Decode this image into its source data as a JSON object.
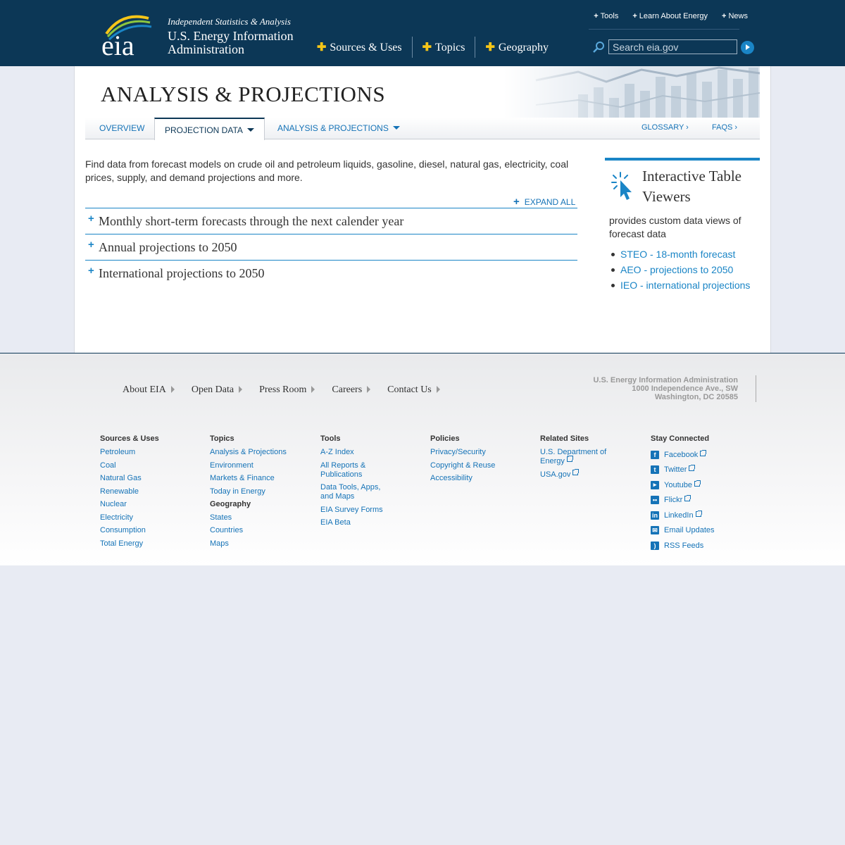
{
  "header": {
    "logo_text": "eia",
    "tagline": "Independent Statistics & Analysis",
    "org_line1": "U.S. Energy Information",
    "org_line2": "Administration",
    "main_nav": [
      "Sources & Uses",
      "Topics",
      "Geography"
    ],
    "util_nav": [
      "Tools",
      "Learn About Energy",
      "News"
    ],
    "search_placeholder": "Search eia.gov"
  },
  "banner": {
    "title": "ANALYSIS & PROJECTIONS"
  },
  "subnav": {
    "tabs": [
      "OVERVIEW",
      "PROJECTION DATA",
      "ANALYSIS & PROJECTIONS"
    ],
    "right_links": [
      "GLOSSARY ›",
      "FAQS ›"
    ],
    "active": "PROJECTION DATA"
  },
  "main": {
    "intro": "Find data from forecast models on crude oil and petroleum liquids, gasoline, diesel, natural gas, electricity, coal prices, supply, and demand projections and more.",
    "expand_all": "EXPAND ALL",
    "accordion": [
      "Monthly short-term forecasts through the next calender year",
      "Annual projections to 2050",
      "International projections to 2050"
    ]
  },
  "sidebar": {
    "title": "Interactive Table Viewers",
    "description": "provides custom data views of forecast data",
    "links": [
      "STEO - 18-month forecast",
      "AEO - projections to 2050",
      "IEO - international projections"
    ]
  },
  "footer": {
    "nav": [
      "About EIA",
      "Open Data",
      "Press Room",
      "Careers",
      "Contact Us"
    ],
    "address": [
      "U.S. Energy Information Administration",
      "1000 Independence Ave., SW",
      "Washington, DC 20585"
    ],
    "columns": {
      "sources": {
        "heading": "Sources & Uses",
        "links": [
          "Petroleum",
          "Coal",
          "Natural Gas",
          "Renewable",
          "Nuclear",
          "Electricity",
          "Consumption",
          "Total Energy"
        ]
      },
      "topics": {
        "heading": "Topics",
        "links": [
          "Analysis & Projections",
          "Environment",
          "Markets & Finance",
          "Today in Energy"
        ],
        "sub_heading": "Geography",
        "sub_links": [
          "States",
          "Countries",
          "Maps"
        ]
      },
      "tools": {
        "heading": "Tools",
        "links": [
          "A-Z Index",
          "All Reports & Publications",
          "Data Tools, Apps, and Maps",
          "EIA Survey Forms",
          "EIA Beta"
        ]
      },
      "policies": {
        "heading": "Policies",
        "links": [
          "Privacy/Security",
          "Copyright & Reuse",
          "Accessibility"
        ]
      },
      "related": {
        "heading": "Related Sites",
        "links": [
          "U.S. Department of Energy",
          "USA.gov"
        ]
      },
      "connect": {
        "heading": "Stay Connected",
        "links": [
          "Facebook",
          "Twitter",
          "Youtube",
          "Flickr",
          "LinkedIn",
          "Email Updates",
          "RSS Feeds"
        ]
      }
    }
  },
  "colors": {
    "header_bg": "#0c3756",
    "link": "#1573b7",
    "accent": "#1a85c6",
    "plus": "#f5c518"
  },
  "icons": [
    "eia-logo",
    "search-icon",
    "search-go-icon",
    "cursor-click-icon",
    "external-link-icon",
    "facebook-icon",
    "twitter-icon",
    "youtube-icon",
    "flickr-icon",
    "linkedin-icon",
    "email-icon",
    "rss-icon"
  ]
}
